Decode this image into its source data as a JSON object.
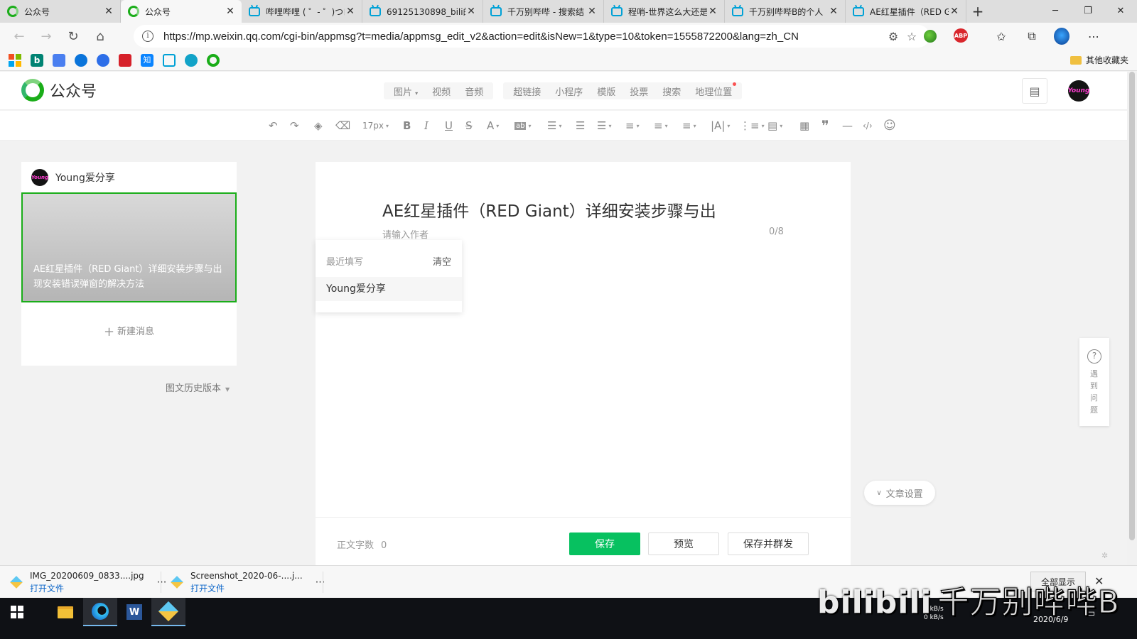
{
  "browser": {
    "tabs": [
      {
        "title": "公众号",
        "favicon": "wechat-icon",
        "active": false
      },
      {
        "title": "公众号",
        "favicon": "wechat-icon",
        "active": true
      },
      {
        "title": "哔哩哔哩 ( ゜- ゜)つロ",
        "favicon": "bilibili-icon",
        "active": false
      },
      {
        "title": "69125130898_bili的",
        "favicon": "bilibili-icon",
        "active": false
      },
      {
        "title": "千万别哔哔 - 搜索结",
        "favicon": "bilibili-icon",
        "active": false
      },
      {
        "title": "程哨-世界这么大还是",
        "favicon": "bilibili-icon",
        "active": false
      },
      {
        "title": "千万别哔哔B的个人",
        "favicon": "bilibili-icon",
        "active": false
      },
      {
        "title": "AE红星插件（RED G",
        "favicon": "bilibili-icon",
        "active": false
      }
    ],
    "url": "https://mp.weixin.qq.com/cgi-bin/appmsg?t=media/appmsg_edit_v2&action=edit&isNew=1&type=10&token=1555872200&lang=zh_CN",
    "bookmarks_folder": "其他收藏夹"
  },
  "header": {
    "logo_text": "公众号",
    "insert_menu_groups": [
      [
        "图片",
        "视频",
        "音频"
      ],
      [
        "超链接",
        "小程序",
        "模版",
        "投票",
        "搜索",
        "地理位置"
      ]
    ],
    "avatar_text": "Young"
  },
  "toolbar": {
    "font_size": "17px"
  },
  "left_panel": {
    "account_name": "Young爱分享",
    "article_title": "AE红星插件（RED Giant）详细安装步骤与出现安装错误弹窗的解决方法",
    "new_message": "新建消息",
    "history": "图文历史版本"
  },
  "editor": {
    "title": "AE红星插件（RED Giant）详细安装步骤与出",
    "author_placeholder": "请输入作者",
    "author_count": "0/8",
    "dropdown": {
      "header": "最近填写",
      "clear": "清空",
      "option": "Young爱分享"
    },
    "word_count_label": "正文字数",
    "word_count": "0",
    "save": "保存",
    "preview": "预览",
    "save_send": "保存并群发"
  },
  "side": {
    "article_settings": "文章设置",
    "help": "遇到问题"
  },
  "downloads": [
    {
      "file": "IMG_20200609_0833....jpg",
      "action": "打开文件"
    },
    {
      "file": "Screenshot_2020-06-....j...",
      "action": "打开文件"
    }
  ],
  "downloads_show_all": "全部显示",
  "taskbar": {
    "watermark_logo": "bilibili",
    "watermark_text": "千万别哔哔B",
    "net_up": "0 kB/s",
    "net_down": "0 kB/s",
    "date": "2020/6/9"
  }
}
